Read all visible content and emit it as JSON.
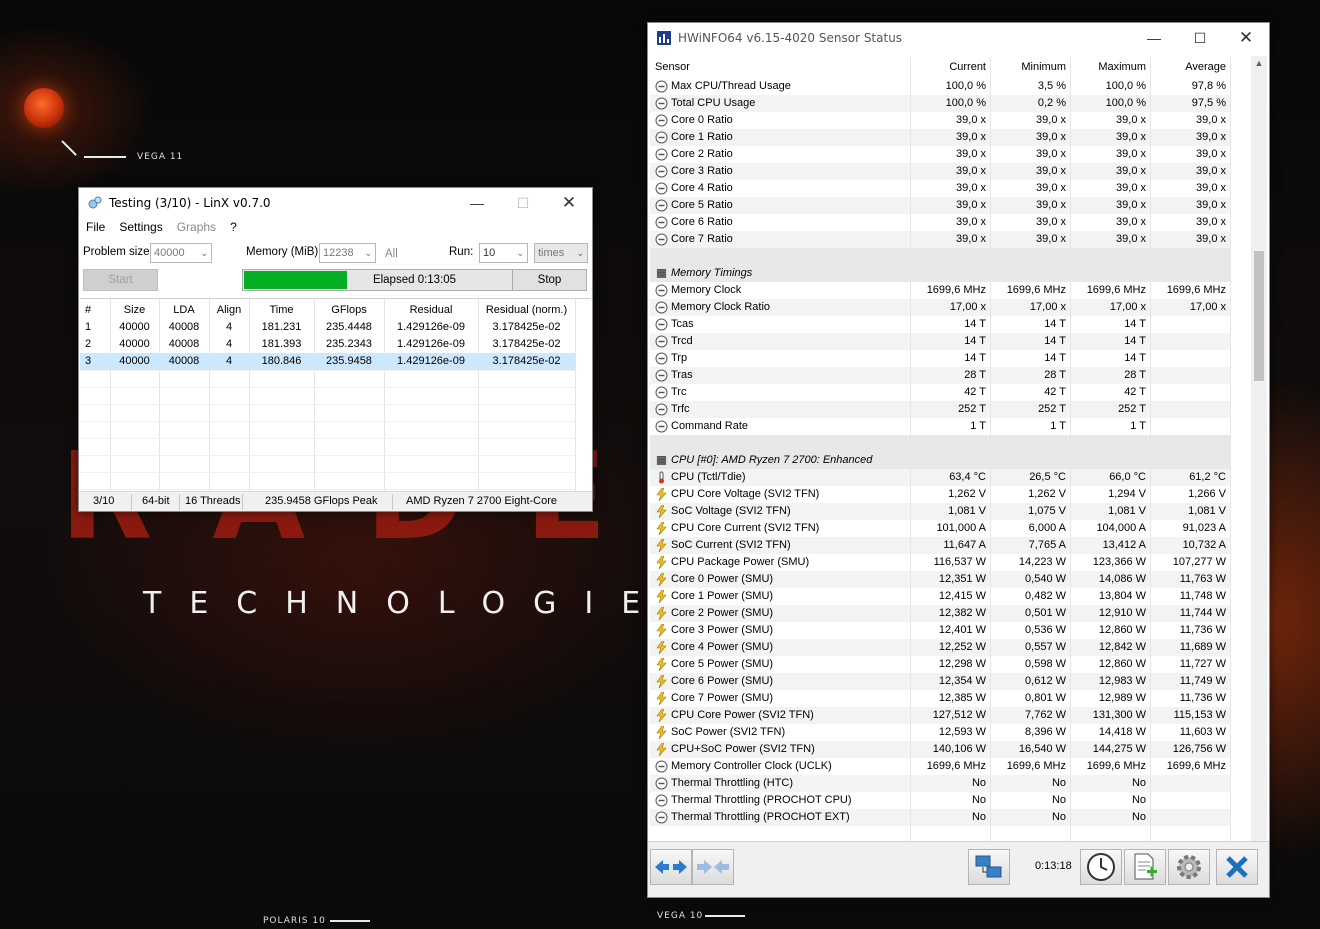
{
  "desktop": {
    "labels": {
      "vega11": "VEGA 11",
      "polaris10": "POLARIS 10",
      "vega10": "VEGA 10"
    },
    "brand_big": "RADE",
    "brand_sub": "TECHNOLOGIE"
  },
  "linx": {
    "title": "Testing (3/10) - LinX v0.7.0",
    "menu": {
      "file": "File",
      "settings": "Settings",
      "graphs": "Graphs",
      "help": "?"
    },
    "problem_size_label": "Problem size:",
    "problem_size_value": "40000",
    "memory_label": "Memory (MiB):",
    "memory_value": "12238",
    "all_label": "All",
    "run_label": "Run:",
    "run_value": "10",
    "run_unit": "times",
    "start_label": "Start",
    "stop_label": "Stop",
    "progress_fraction": 0.3,
    "elapsed": "Elapsed 0:13:05",
    "columns": [
      "#",
      "Size",
      "LDA",
      "Align",
      "Time",
      "GFlops",
      "Residual",
      "Residual (norm.)"
    ],
    "rows": [
      [
        "1",
        "40000",
        "40008",
        "4",
        "181.231",
        "235.4448",
        "1.429126e-09",
        "3.178425e-02"
      ],
      [
        "2",
        "40000",
        "40008",
        "4",
        "181.393",
        "235.2343",
        "1.429126e-09",
        "3.178425e-02"
      ],
      [
        "3",
        "40000",
        "40008",
        "4",
        "180.846",
        "235.9458",
        "1.429126e-09",
        "3.178425e-02"
      ]
    ],
    "status": {
      "progress": "3/10",
      "bits": "64-bit",
      "threads": "16 Threads",
      "peak": "235.9458 GFlops Peak",
      "cpu": "AMD Ryzen 7 2700 Eight-Core"
    }
  },
  "hwinfo": {
    "title": "HWiNFO64 v6.15-4020 Sensor Status",
    "columns": [
      "Sensor",
      "Current",
      "Minimum",
      "Maximum",
      "Average"
    ],
    "rows": [
      {
        "n": "Max CPU/Thread Usage",
        "c": "100,0 %",
        "mi": "3,5 %",
        "ma": "100,0 %",
        "a": "97,8 %",
        "i": "circle"
      },
      {
        "n": "Total CPU Usage",
        "c": "100,0 %",
        "mi": "0,2 %",
        "ma": "100,0 %",
        "a": "97,5 %",
        "i": "circle"
      },
      {
        "n": "Core 0 Ratio",
        "c": "39,0 x",
        "mi": "39,0 x",
        "ma": "39,0 x",
        "a": "39,0 x",
        "i": "circle"
      },
      {
        "n": "Core 1 Ratio",
        "c": "39,0 x",
        "mi": "39,0 x",
        "ma": "39,0 x",
        "a": "39,0 x",
        "i": "circle"
      },
      {
        "n": "Core 2 Ratio",
        "c": "39,0 x",
        "mi": "39,0 x",
        "ma": "39,0 x",
        "a": "39,0 x",
        "i": "circle"
      },
      {
        "n": "Core 3 Ratio",
        "c": "39,0 x",
        "mi": "39,0 x",
        "ma": "39,0 x",
        "a": "39,0 x",
        "i": "circle"
      },
      {
        "n": "Core 4 Ratio",
        "c": "39,0 x",
        "mi": "39,0 x",
        "ma": "39,0 x",
        "a": "39,0 x",
        "i": "circle"
      },
      {
        "n": "Core 5 Ratio",
        "c": "39,0 x",
        "mi": "39,0 x",
        "ma": "39,0 x",
        "a": "39,0 x",
        "i": "circle"
      },
      {
        "n": "Core 6 Ratio",
        "c": "39,0 x",
        "mi": "39,0 x",
        "ma": "39,0 x",
        "a": "39,0 x",
        "i": "circle"
      },
      {
        "n": "Core 7 Ratio",
        "c": "39,0 x",
        "mi": "39,0 x",
        "ma": "39,0 x",
        "a": "39,0 x",
        "i": "circle"
      },
      {
        "n": "",
        "c": "",
        "mi": "",
        "ma": "",
        "a": "",
        "i": "blank"
      },
      {
        "n": "Memory Timings",
        "c": "",
        "mi": "",
        "ma": "",
        "a": "",
        "i": "chip"
      },
      {
        "n": "Memory Clock",
        "c": "1699,6 MHz",
        "mi": "1699,6 MHz",
        "ma": "1699,6 MHz",
        "a": "1699,6 MHz",
        "i": "circle"
      },
      {
        "n": "Memory Clock Ratio",
        "c": "17,00 x",
        "mi": "17,00 x",
        "ma": "17,00 x",
        "a": "17,00 x",
        "i": "circle"
      },
      {
        "n": "Tcas",
        "c": "14 T",
        "mi": "14 T",
        "ma": "14 T",
        "a": "",
        "i": "circle"
      },
      {
        "n": "Trcd",
        "c": "14 T",
        "mi": "14 T",
        "ma": "14 T",
        "a": "",
        "i": "circle"
      },
      {
        "n": "Trp",
        "c": "14 T",
        "mi": "14 T",
        "ma": "14 T",
        "a": "",
        "i": "circle"
      },
      {
        "n": "Tras",
        "c": "28 T",
        "mi": "28 T",
        "ma": "28 T",
        "a": "",
        "i": "circle"
      },
      {
        "n": "Trc",
        "c": "42 T",
        "mi": "42 T",
        "ma": "42 T",
        "a": "",
        "i": "circle"
      },
      {
        "n": "Trfc",
        "c": "252 T",
        "mi": "252 T",
        "ma": "252 T",
        "a": "",
        "i": "circle"
      },
      {
        "n": "Command Rate",
        "c": "1 T",
        "mi": "1 T",
        "ma": "1 T",
        "a": "",
        "i": "circle"
      },
      {
        "n": "",
        "c": "",
        "mi": "",
        "ma": "",
        "a": "",
        "i": "blank"
      },
      {
        "n": "CPU [#0]: AMD Ryzen 7 2700: Enhanced",
        "c": "",
        "mi": "",
        "ma": "",
        "a": "",
        "i": "chip"
      },
      {
        "n": "CPU (Tctl/Tdie)",
        "c": "63,4 °C",
        "mi": "26,5 °C",
        "ma": "66,0 °C",
        "a": "61,2 °C",
        "i": "thermo"
      },
      {
        "n": "CPU Core Voltage (SVI2 TFN)",
        "c": "1,262 V",
        "mi": "1,262 V",
        "ma": "1,294 V",
        "a": "1,266 V",
        "i": "bolt"
      },
      {
        "n": "SoC Voltage (SVI2 TFN)",
        "c": "1,081 V",
        "mi": "1,075 V",
        "ma": "1,081 V",
        "a": "1,081 V",
        "i": "bolt"
      },
      {
        "n": "CPU Core Current (SVI2 TFN)",
        "c": "101,000 A",
        "mi": "6,000 A",
        "ma": "104,000 A",
        "a": "91,023 A",
        "i": "bolt"
      },
      {
        "n": "SoC Current (SVI2 TFN)",
        "c": "11,647 A",
        "mi": "7,765 A",
        "ma": "13,412 A",
        "a": "10,732 A",
        "i": "bolt"
      },
      {
        "n": "CPU Package Power (SMU)",
        "c": "116,537 W",
        "mi": "14,223 W",
        "ma": "123,366 W",
        "a": "107,277 W",
        "i": "bolt"
      },
      {
        "n": "Core 0 Power (SMU)",
        "c": "12,351 W",
        "mi": "0,540 W",
        "ma": "14,086 W",
        "a": "11,763 W",
        "i": "bolt"
      },
      {
        "n": "Core 1 Power (SMU)",
        "c": "12,415 W",
        "mi": "0,482 W",
        "ma": "13,804 W",
        "a": "11,748 W",
        "i": "bolt"
      },
      {
        "n": "Core 2 Power (SMU)",
        "c": "12,382 W",
        "mi": "0,501 W",
        "ma": "12,910 W",
        "a": "11,744 W",
        "i": "bolt"
      },
      {
        "n": "Core 3 Power (SMU)",
        "c": "12,401 W",
        "mi": "0,536 W",
        "ma": "12,860 W",
        "a": "11,736 W",
        "i": "bolt"
      },
      {
        "n": "Core 4 Power (SMU)",
        "c": "12,252 W",
        "mi": "0,557 W",
        "ma": "12,842 W",
        "a": "11,689 W",
        "i": "bolt"
      },
      {
        "n": "Core 5 Power (SMU)",
        "c": "12,298 W",
        "mi": "0,598 W",
        "ma": "12,860 W",
        "a": "11,727 W",
        "i": "bolt"
      },
      {
        "n": "Core 6 Power (SMU)",
        "c": "12,354 W",
        "mi": "0,612 W",
        "ma": "12,983 W",
        "a": "11,749 W",
        "i": "bolt"
      },
      {
        "n": "Core 7 Power (SMU)",
        "c": "12,385 W",
        "mi": "0,801 W",
        "ma": "12,989 W",
        "a": "11,736 W",
        "i": "bolt"
      },
      {
        "n": "CPU Core Power (SVI2 TFN)",
        "c": "127,512 W",
        "mi": "7,762 W",
        "ma": "131,300 W",
        "a": "115,153 W",
        "i": "bolt"
      },
      {
        "n": "SoC Power (SVI2 TFN)",
        "c": "12,593 W",
        "mi": "8,396 W",
        "ma": "14,418 W",
        "a": "11,603 W",
        "i": "bolt"
      },
      {
        "n": "CPU+SoC Power (SVI2 TFN)",
        "c": "140,106 W",
        "mi": "16,540 W",
        "ma": "144,275 W",
        "a": "126,756 W",
        "i": "bolt"
      },
      {
        "n": "Memory Controller Clock (UCLK)",
        "c": "1699,6 MHz",
        "mi": "1699,6 MHz",
        "ma": "1699,6 MHz",
        "a": "1699,6 MHz",
        "i": "circle"
      },
      {
        "n": "Thermal Throttling (HTC)",
        "c": "No",
        "mi": "No",
        "ma": "No",
        "a": "",
        "i": "circle"
      },
      {
        "n": "Thermal Throttling (PROCHOT CPU)",
        "c": "No",
        "mi": "No",
        "ma": "No",
        "a": "",
        "i": "circle"
      },
      {
        "n": "Thermal Throttling (PROCHOT EXT)",
        "c": "No",
        "mi": "No",
        "ma": "No",
        "a": "",
        "i": "circle"
      }
    ],
    "timer": "0:13:18",
    "icons": [
      "nav-arrows-icon",
      "collapse-arrows-icon",
      "network-icon",
      "clock-icon",
      "add-report-icon",
      "gear-icon",
      "close-x-icon"
    ]
  },
  "colors": {
    "progress_green": "#06b025",
    "selection_blue": "#cce8ff",
    "bolt_yellow": "#f0c020",
    "thermo_red": "#d83020"
  }
}
